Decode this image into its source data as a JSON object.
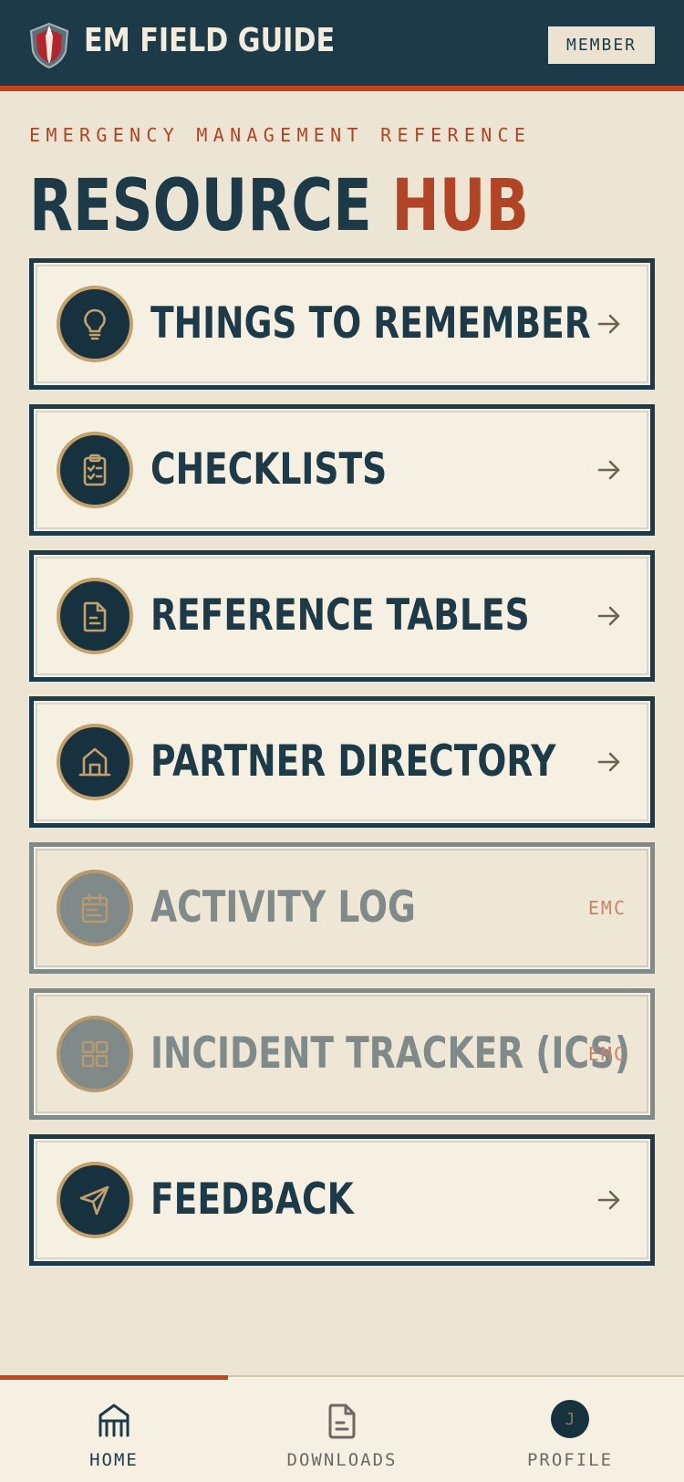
{
  "header": {
    "app_title": "EM FIELD GUIDE",
    "member_badge": "MEMBER",
    "logo_icon": "shield-flame-logo"
  },
  "hero": {
    "eyebrow": "EMERGENCY MANAGEMENT REFERENCE",
    "title_main": "RESOURCE",
    "title_accent": "HUB"
  },
  "cards": [
    {
      "label": "THINGS TO REMEMBER",
      "icon": "lightbulb-icon",
      "enabled": true
    },
    {
      "label": "CHECKLISTS",
      "icon": "clipboard-check-icon",
      "enabled": true
    },
    {
      "label": "REFERENCE TABLES",
      "icon": "document-icon",
      "enabled": true
    },
    {
      "label": "PARTNER DIRECTORY",
      "icon": "building-icon",
      "enabled": true
    },
    {
      "label": "ACTIVITY LOG",
      "icon": "calendar-icon",
      "enabled": false,
      "tag": "EMC"
    },
    {
      "label": "INCIDENT TRACKER (ICS)",
      "icon": "grid-icon",
      "enabled": false,
      "tag": "EMC"
    },
    {
      "label": "FEEDBACK",
      "icon": "send-icon",
      "enabled": true
    }
  ],
  "bottom_nav": {
    "items": [
      {
        "label": "HOME",
        "icon": "home-icon",
        "active": true
      },
      {
        "label": "DOWNLOADS",
        "icon": "document-icon",
        "active": false
      },
      {
        "label": "PROFILE",
        "icon": "avatar",
        "active": false
      }
    ],
    "avatar_initial": "J"
  },
  "colors": {
    "navy": "#1c3a47",
    "rust": "#c2451c",
    "gold": "#c4a06a",
    "cream": "#ede5d3",
    "disabled": "#808a89"
  }
}
